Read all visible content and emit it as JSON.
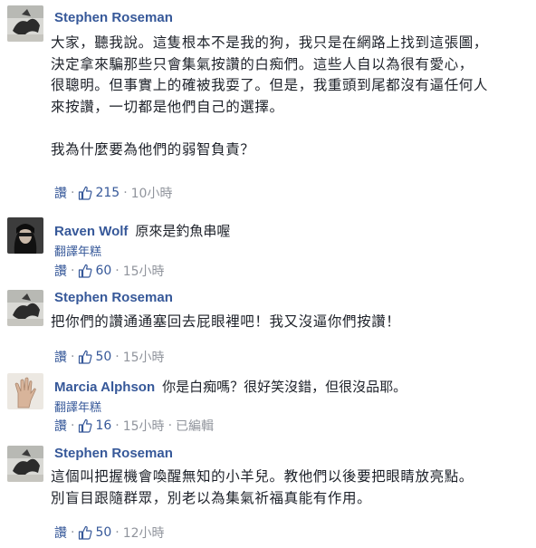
{
  "comments": [
    {
      "author": "Stephen Roseman",
      "lines": [
        "大家，聽我說。這隻根本不是我的狗，我只是在網路上找到這張圖，",
        "決定拿來騙那些只會集氣按讚的白痴們。這些人自以為很有愛心，",
        "很聰明。但事實上的確被我耍了。但是，我重頭到尾都沒有逼任何人",
        "來按讚，一切都是他們自己的選擇。",
        "",
        "我為什麼要為他們的弱智負責？"
      ],
      "like_label": "讚",
      "like_count": "215",
      "time": "10小時"
    },
    {
      "author": "Raven Wolf",
      "inline_text": "原來是釣魚串喔",
      "translate_label": "翻譯年糕",
      "like_label": "讚",
      "like_count": "60",
      "time": "15小時"
    },
    {
      "author": "Stephen Roseman",
      "lines": [
        "把你們的讚通通塞回去屁眼裡吧！我又沒逼你們按讚！"
      ],
      "like_label": "讚",
      "like_count": "50",
      "time": "15小時"
    },
    {
      "author": "Marcia Alphson",
      "inline_text": "你是白痴嗎？很好笑沒錯，但很沒品耶。",
      "translate_label": "翻譯年糕",
      "like_label": "讚",
      "like_count": "16",
      "time": "15小時",
      "edited": "已編輯"
    },
    {
      "author": "Stephen Roseman",
      "lines": [
        "這個叫把握機會喚醒無知的小羊兒。教他們以後要把眼睛放亮點。",
        "別盲目跟隨群眾，別老以為集氣祈福真能有作用。"
      ],
      "like_label": "讚",
      "like_count": "50",
      "time": "12小時"
    }
  ],
  "separator": "·",
  "colors": {
    "link": "#365899",
    "meta": "#90949c",
    "text": "#1d2129"
  },
  "icons": {
    "like": "thumbs-up-icon"
  }
}
